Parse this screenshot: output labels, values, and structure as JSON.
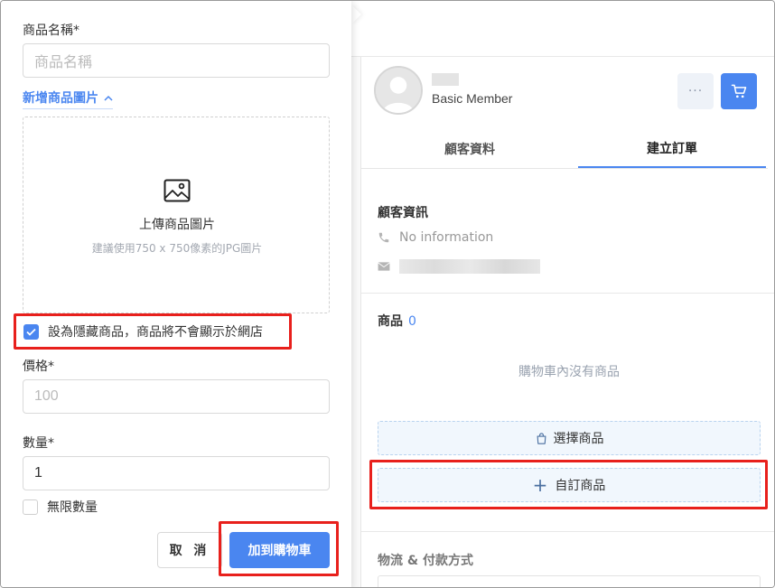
{
  "customer_panel": {
    "member_level": "Basic Member",
    "more_icon": "more-dots-icon",
    "cart_icon": "cart-icon",
    "tabs": [
      {
        "label": "顧客資料",
        "active": false
      },
      {
        "label": "建立訂單",
        "active": true
      }
    ],
    "customer_info_title": "顧客資訊",
    "phone_text": "No information",
    "products_title": "商品",
    "products_count": "0",
    "empty_cart_text": "購物車內沒有商品",
    "select_products_label": "選擇商品",
    "custom_product_label": "自訂商品",
    "shipping_payment_title": "物流 & 付款方式"
  },
  "custom_product_form": {
    "name_label": "商品名稱*",
    "name_placeholder": "商品名稱",
    "add_image_label": "新增商品圖片",
    "upload_title": "上傳商品圖片",
    "upload_hint": "建議使用750 x 750像素的JPG圖片",
    "hidden_product_label": "設為隱藏商品，商品將不會顯示於網店",
    "hidden_product_checked": true,
    "price_label": "價格*",
    "price_placeholder": "100",
    "quantity_label": "數量*",
    "quantity_value": "1",
    "unlimited_label": "無限數量",
    "unlimited_checked": false,
    "cancel_label": "取 消",
    "add_to_cart_label": "加到購物車"
  },
  "colors": {
    "accent": "#4a86f0",
    "highlight_outline": "#e8201c"
  }
}
